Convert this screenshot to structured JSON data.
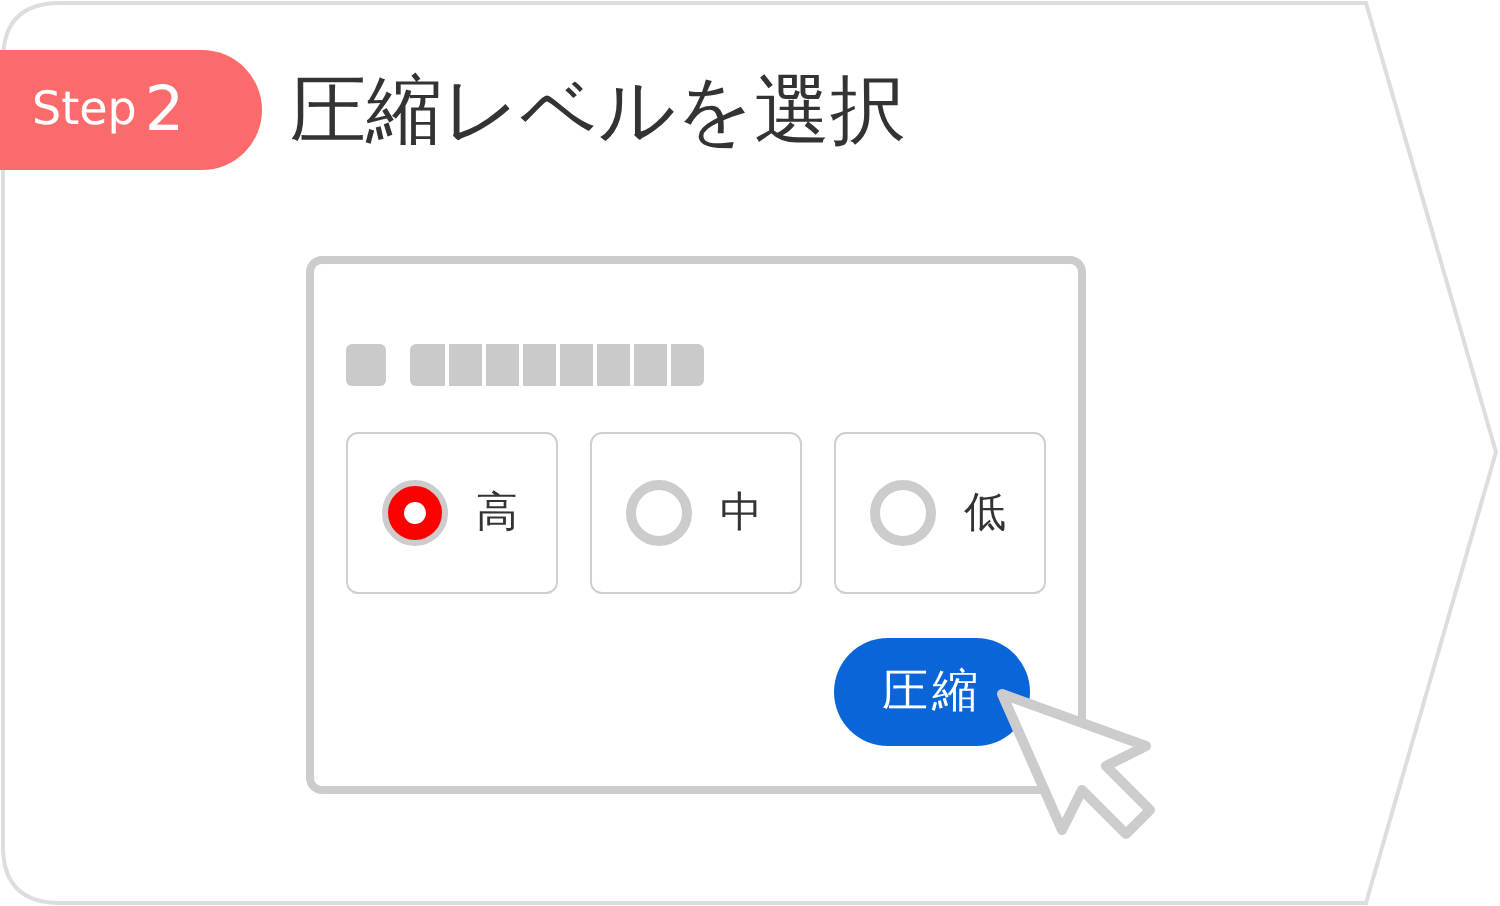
{
  "step": {
    "label": "Step",
    "number": "2"
  },
  "title": "圧縮レベルを選択",
  "options": [
    {
      "label": "高",
      "selected": true
    },
    {
      "label": "中",
      "selected": false
    },
    {
      "label": "低",
      "selected": false
    }
  ],
  "button": "圧縮"
}
